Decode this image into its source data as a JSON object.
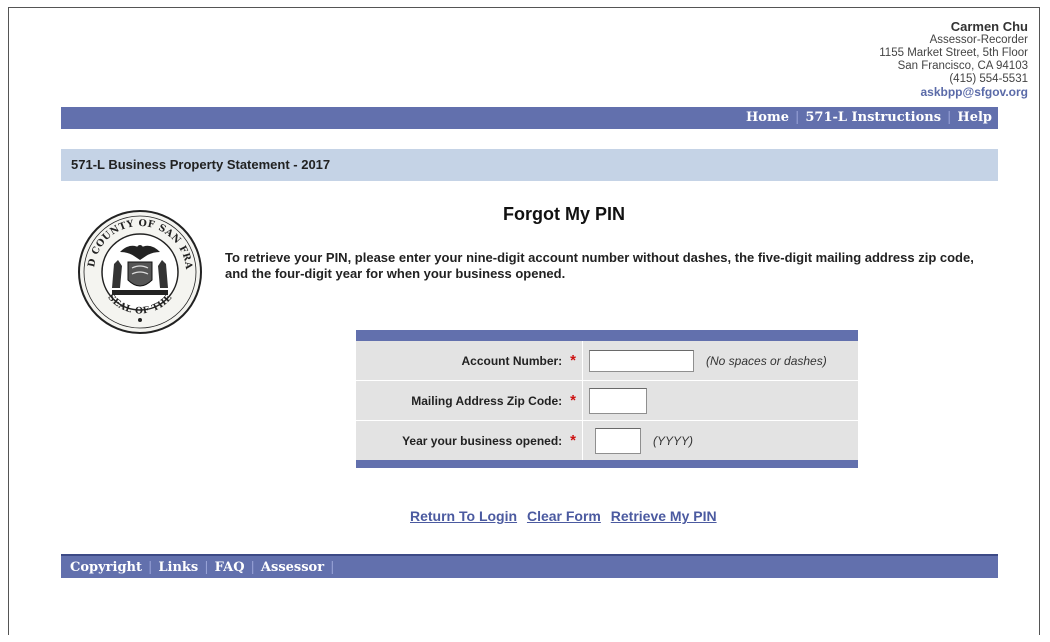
{
  "contact": {
    "name": "Carmen Chu",
    "title": "Assessor-Recorder",
    "address1": "1155 Market Street, 5th Floor",
    "address2": "San Francisco, CA 94103",
    "phone": "(415) 554-5531",
    "email": "askbpp@sfgov.org"
  },
  "topnav": {
    "items": [
      "Home",
      "571-L Instructions",
      "Help"
    ]
  },
  "subbar": {
    "title": "571-L Business Property Statement - 2017"
  },
  "seal": {
    "icon": "city-county-seal-icon",
    "text_top": "CITY AND COUNTY OF SAN FRANCISCO",
    "text_bottom": "SEAL OF THE"
  },
  "page": {
    "title": "Forgot My PIN",
    "instructions": "To retrieve your PIN, please enter your nine-digit account number without dashes, the five-digit mailing address zip code, and the four-digit year for when your business opened."
  },
  "form": {
    "required_mark": "*",
    "fields": [
      {
        "label": "Account Number:",
        "value": "",
        "hint": "(No spaces or dashes)"
      },
      {
        "label": "Mailing Address Zip Code:",
        "value": "",
        "hint": ""
      },
      {
        "label": "Year your business opened:",
        "value": "",
        "hint": "(YYYY)"
      }
    ]
  },
  "actions": {
    "return_login": "Return To Login",
    "clear_form": "Clear Form",
    "retrieve_pin": "Retrieve My PIN"
  },
  "footnav": {
    "items": [
      "Copyright",
      "Links",
      "FAQ",
      "Assessor"
    ]
  },
  "colors": {
    "nav_bg": "#6270ad",
    "subbar_bg": "#c5d3e6",
    "form_bg": "#e3e3e3",
    "required": "#cc1111",
    "link": "#4b5aa0"
  }
}
